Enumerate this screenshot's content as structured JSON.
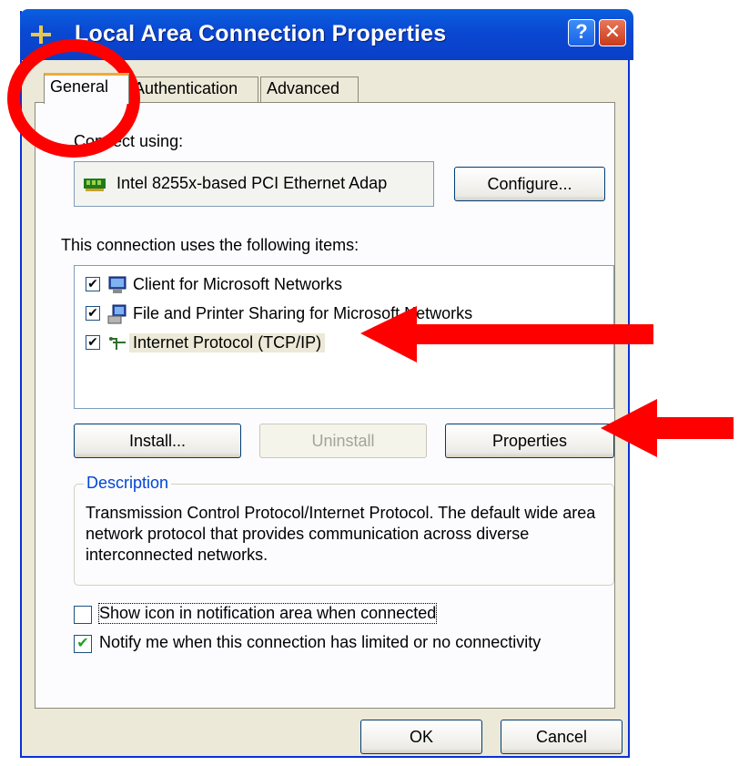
{
  "window": {
    "title": "Local Area Connection Properties",
    "help_glyph": "?",
    "close_glyph": "✕"
  },
  "tabs": [
    {
      "label": "General",
      "active": true
    },
    {
      "label": "Authentication",
      "active": false
    },
    {
      "label": "Advanced",
      "active": false
    }
  ],
  "general": {
    "connect_using_label": "Connect using:",
    "adapter_name": "Intel 8255x-based PCI Ethernet Adap",
    "configure_button": "Configure...",
    "items_label": "This connection uses the following items:",
    "items": [
      {
        "label": "Client for Microsoft Networks",
        "checked": true,
        "icon": "network-client-icon"
      },
      {
        "label": "File and Printer Sharing for Microsoft Networks",
        "checked": true,
        "icon": "file-printer-sharing-icon"
      },
      {
        "label": "Internet Protocol (TCP/IP)",
        "checked": true,
        "selected": true,
        "icon": "protocol-icon"
      }
    ],
    "install_button": "Install...",
    "uninstall_button": "Uninstall",
    "properties_button": "Properties",
    "description_title": "Description",
    "description_text": "Transmission Control Protocol/Internet Protocol. The default wide area network protocol that provides communication across diverse interconnected networks.",
    "show_icon_label": "Show icon in notification area when connected",
    "show_icon_checked": false,
    "notify_label": "Notify me when this connection has limited or no connectivity",
    "notify_checked": true
  },
  "footer": {
    "ok_button": "OK",
    "cancel_button": "Cancel"
  },
  "check_glyph": "✔",
  "colors": {
    "annotation_red": "#ff0000",
    "title_bar_blue": "#0a48d2",
    "group_title_blue": "#0046d5"
  }
}
